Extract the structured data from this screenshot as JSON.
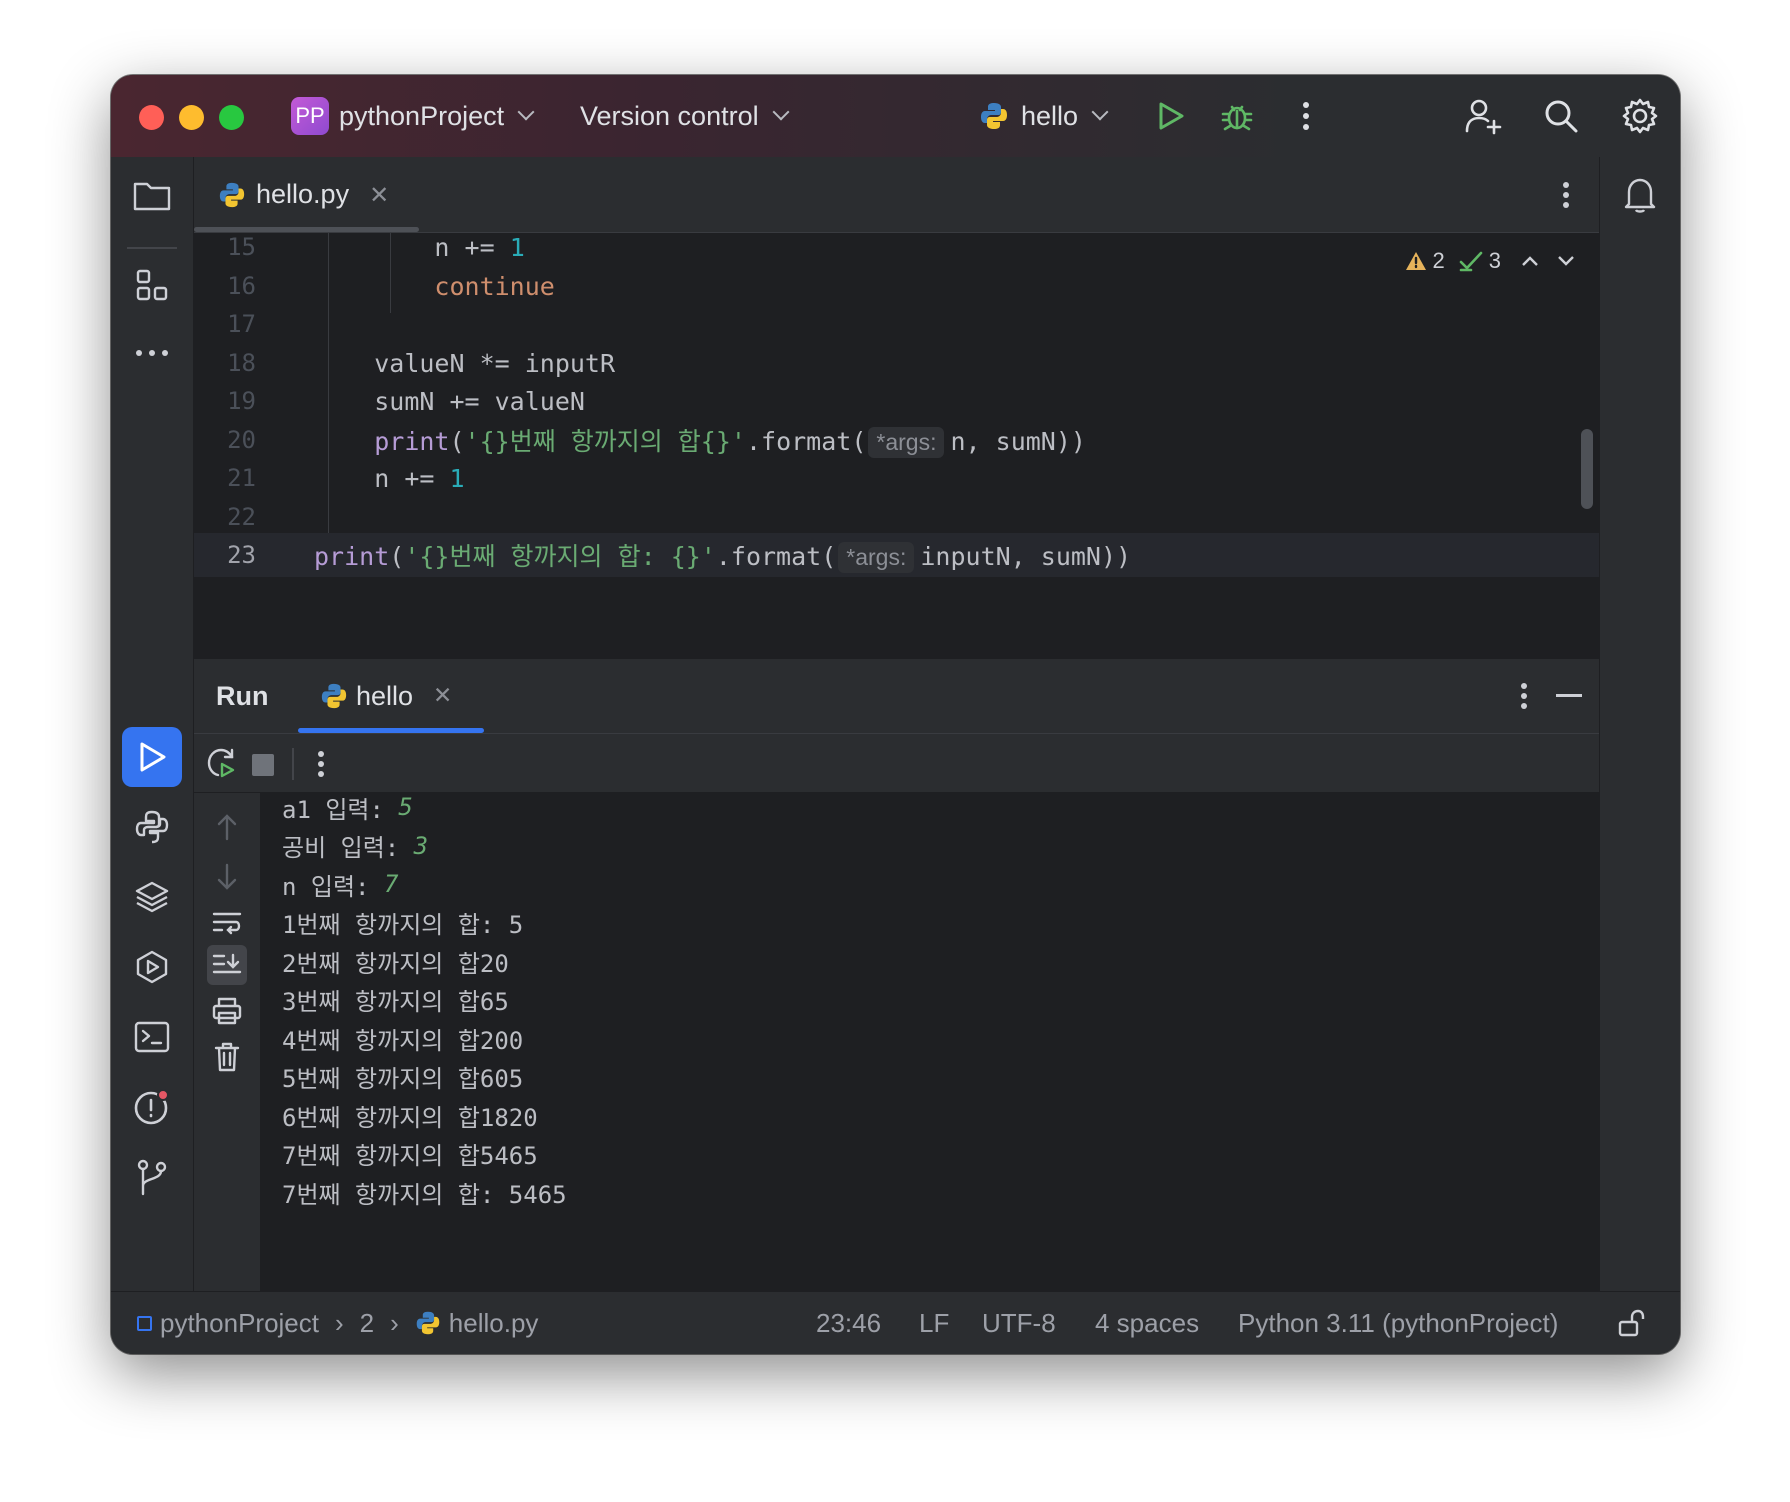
{
  "titlebar": {
    "project_badge": "PP",
    "project_name": "pythonProject",
    "vcs_label": "Version control",
    "run_config": "hello",
    "colors": {
      "close": "#ff5f57",
      "minimize": "#febc2e",
      "maximize": "#28c840"
    }
  },
  "tabs": [
    {
      "label": "hello.py"
    }
  ],
  "inspections": {
    "warnings": "2",
    "ok": "3"
  },
  "editor": {
    "lines": [
      {
        "num": "15",
        "indent": "        ",
        "parts": [
          {
            "t": "n += ",
            "c": ""
          },
          {
            "t": "1",
            "c": "num"
          }
        ]
      },
      {
        "num": "16",
        "indent": "        ",
        "parts": [
          {
            "t": "continue",
            "c": "kw"
          }
        ]
      },
      {
        "num": "17",
        "indent": "",
        "parts": []
      },
      {
        "num": "18",
        "indent": "    ",
        "parts": [
          {
            "t": "valueN *= inputR",
            "c": ""
          }
        ]
      },
      {
        "num": "19",
        "indent": "    ",
        "parts": [
          {
            "t": "sumN += valueN",
            "c": ""
          }
        ]
      },
      {
        "num": "20",
        "indent": "    ",
        "parts": [
          {
            "t": "print",
            "c": "fn"
          },
          {
            "t": "(",
            "c": ""
          },
          {
            "t": "'{}번째 항까지의 합{}'",
            "c": "str"
          },
          {
            "t": ".format(",
            "c": ""
          },
          {
            "t": "*args:",
            "c": "hint"
          },
          {
            "t": "n, sumN))",
            "c": ""
          }
        ]
      },
      {
        "num": "21",
        "indent": "    ",
        "parts": [
          {
            "t": "n += ",
            "c": ""
          },
          {
            "t": "1",
            "c": "num"
          }
        ]
      },
      {
        "num": "22",
        "indent": "",
        "parts": []
      },
      {
        "num": "23",
        "indent": "",
        "parts": [
          {
            "t": "print",
            "c": "fn"
          },
          {
            "t": "(",
            "c": ""
          },
          {
            "t": "'{}번째 항까지의 합: {}'",
            "c": "str"
          },
          {
            "t": ".format(",
            "c": ""
          },
          {
            "t": "*args:",
            "c": "hint"
          },
          {
            "t": "inputN, sumN))",
            "c": ""
          }
        ]
      }
    ]
  },
  "run": {
    "title": "Run",
    "tab_label": "hello",
    "output": [
      {
        "text": "a1 입력: ",
        "input": "5"
      },
      {
        "text": "공비 입력: ",
        "input": "3"
      },
      {
        "text": "n 입력: ",
        "input": "7"
      },
      {
        "text": "1번째 항까지의 합: 5",
        "input": ""
      },
      {
        "text": "2번째 항까지의 합20",
        "input": ""
      },
      {
        "text": "3번째 항까지의 합65",
        "input": ""
      },
      {
        "text": "4번째 항까지의 합200",
        "input": ""
      },
      {
        "text": "5번째 항까지의 합605",
        "input": ""
      },
      {
        "text": "6번째 항까지의 합1820",
        "input": ""
      },
      {
        "text": "7번째 항까지의 합5465",
        "input": ""
      },
      {
        "text": "7번째 항까지의 합: 5465",
        "input": ""
      }
    ]
  },
  "statusbar": {
    "breadcrumb": [
      "pythonProject",
      "2",
      "hello.py"
    ],
    "position": "23:46",
    "line_sep": "LF",
    "encoding": "UTF-8",
    "indent": "4 spaces",
    "interpreter": "Python 3.11 (pythonProject)"
  }
}
